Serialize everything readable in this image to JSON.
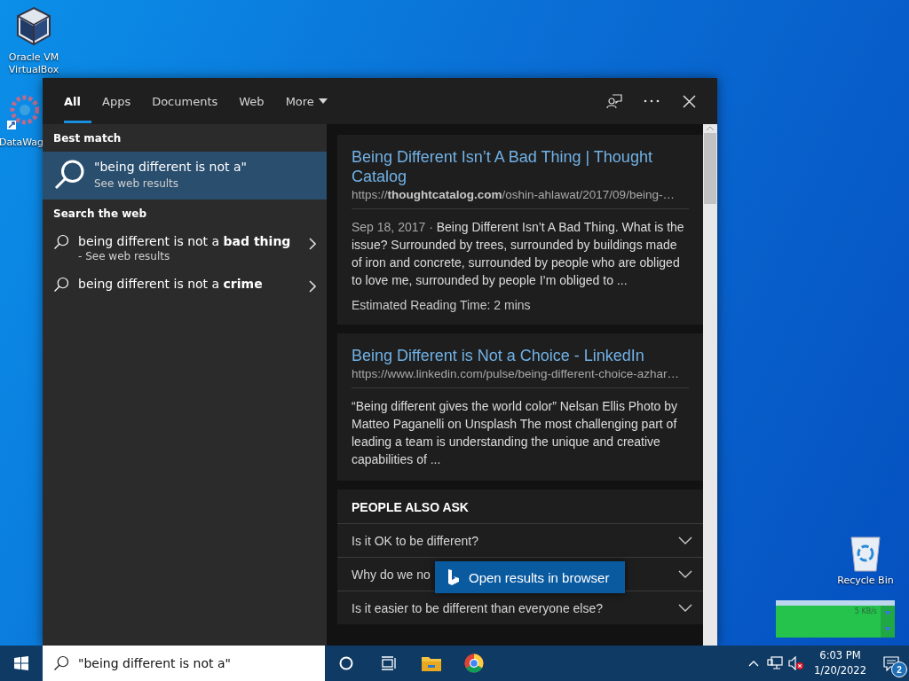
{
  "desktop_icons": [
    {
      "label": "Oracle VM VirtualBox",
      "kind": "virtualbox"
    },
    {
      "label": "DataWag",
      "kind": "datawag"
    },
    {
      "label": "Recycle Bin",
      "kind": "recycle"
    }
  ],
  "net_meter": {
    "reading": "5 KB/s"
  },
  "search_panel": {
    "tabs": [
      {
        "label": "All",
        "selected": true,
        "kind": "tab"
      },
      {
        "label": "Apps",
        "selected": false,
        "kind": "tab"
      },
      {
        "label": "Documents",
        "selected": false,
        "kind": "tab"
      },
      {
        "label": "Web",
        "selected": false,
        "kind": "tab"
      },
      {
        "label": "More",
        "selected": false,
        "kind": "dropdown"
      }
    ],
    "best_match": {
      "heading": "Best match",
      "title": "\"being different is not a\"",
      "subtitle": "See web results",
      "selected": true
    },
    "search_the_web": {
      "heading": "Search the web",
      "suggestions": [
        {
          "text": "being different is not a **bad thing**",
          "subtitle": "- See web results",
          "selected": false
        },
        {
          "text": "being different is not a **crime**",
          "selected": false
        }
      ]
    },
    "results": [
      {
        "title": "Being Different Isn’t A Bad Thing | Thought Catalog",
        "url": "https://**thoughtcatalog.com**/oshin-ahlawat/2017/09/being-…",
        "date": "Sep 18, 2017 ·",
        "snippet": "Being Different Isn’t A Bad Thing. What is the issue? Surrounded by trees, surrounded by buildings made of iron and concrete, surrounded by people who are obliged to love me, surrounded by people I’m obliged to ...",
        "note": "Estimated Reading Time: 2 mins"
      },
      {
        "title": "Being Different is Not a Choice - LinkedIn",
        "url": "https://www.linkedin.com/pulse/being-different-choice-azhar…",
        "snippet": "“Being different gives the world color” Nelsan Ellis Photo by Matteo Paganelli on Unsplash The most challenging part of leading a team is understanding the unique and creative capabilities of ..."
      }
    ],
    "people_also_ask": {
      "heading": "PEOPLE ALSO ASK",
      "questions": [
        {
          "text": "Is it OK to be different?",
          "expanded": false
        },
        {
          "text": "Why do we no",
          "expanded": false
        },
        {
          "text": "Is it easier to be different than everyone else?",
          "expanded": false
        }
      ]
    },
    "open_button": "Open results in browser"
  },
  "taskbar": {
    "search_value": "\"being different is not a\"",
    "volume_muted": true,
    "time": "6:03 PM",
    "date": "1/20/2022",
    "notification_count": "2"
  }
}
